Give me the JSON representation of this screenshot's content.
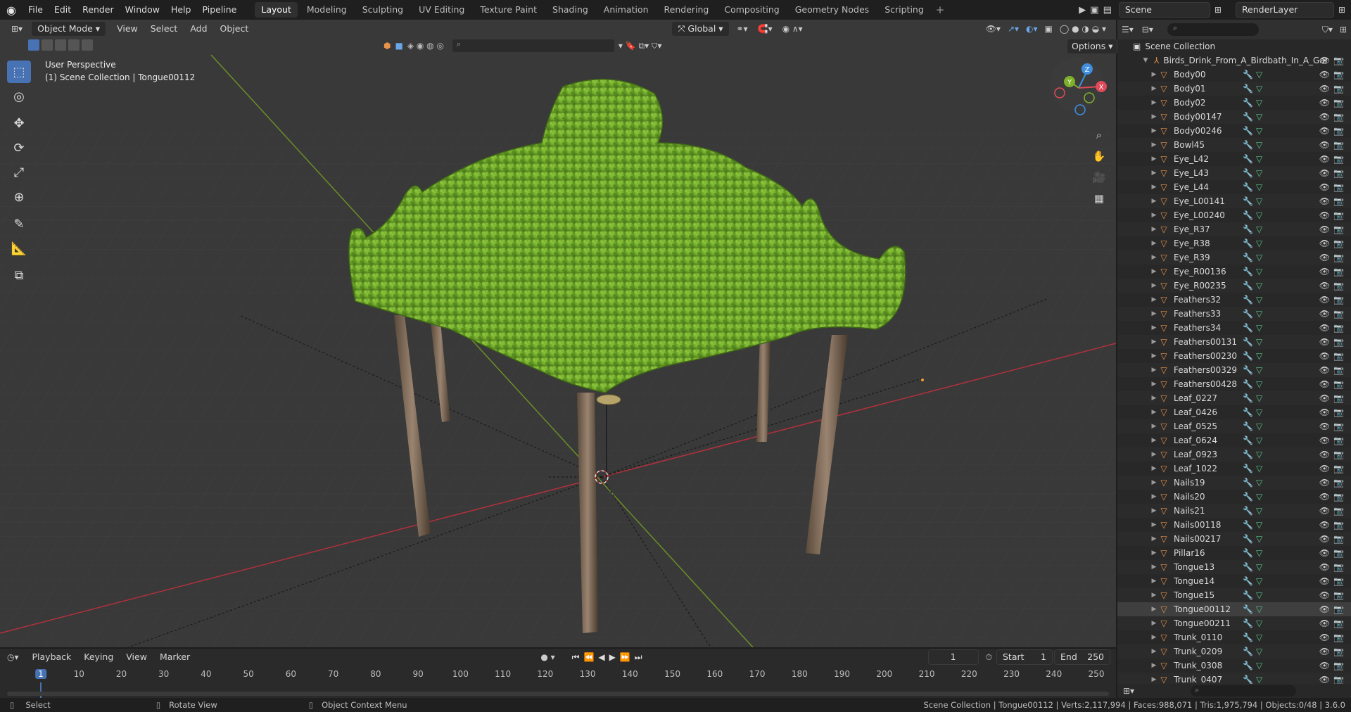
{
  "topbar": {
    "menus": [
      "File",
      "Edit",
      "Render",
      "Window",
      "Help",
      "Pipeline"
    ],
    "workspaces": [
      "Layout",
      "Modeling",
      "Sculpting",
      "UV Editing",
      "Texture Paint",
      "Shading",
      "Animation",
      "Rendering",
      "Compositing",
      "Geometry Nodes",
      "Scripting"
    ],
    "active_workspace": "Layout",
    "scene_name": "Scene",
    "render_layer": "RenderLayer"
  },
  "viewport": {
    "mode": "Object Mode",
    "menus": [
      "View",
      "Select",
      "Add",
      "Object"
    ],
    "transform_orientation": "Global",
    "options_label": "Options",
    "perspective_label": "User Perspective",
    "collection_label": "(1) Scene Collection | Tongue00112"
  },
  "outliner": {
    "root": "Scene Collection",
    "collection": "Birds_Drink_From_A_Birdbath_In_A_Gar",
    "objects": [
      "Body00",
      "Body01",
      "Body02",
      "Body00147",
      "Body00246",
      "Bowl45",
      "Eye_L42",
      "Eye_L43",
      "Eye_L44",
      "Eye_L00141",
      "Eye_L00240",
      "Eye_R37",
      "Eye_R38",
      "Eye_R39",
      "Eye_R00136",
      "Eye_R00235",
      "Feathers32",
      "Feathers33",
      "Feathers34",
      "Feathers00131",
      "Feathers00230",
      "Feathers00329",
      "Feathers00428",
      "Leaf_0227",
      "Leaf_0426",
      "Leaf_0525",
      "Leaf_0624",
      "Leaf_0923",
      "Leaf_1022",
      "Nails19",
      "Nails20",
      "Nails21",
      "Nails00118",
      "Nails00217",
      "Pillar16",
      "Tongue13",
      "Tongue14",
      "Tongue15",
      "Tongue00112",
      "Tongue00211",
      "Trunk_0110",
      "Trunk_0209",
      "Trunk_0308",
      "Trunk_0407"
    ],
    "selected": "Tongue00112"
  },
  "timeline": {
    "menus": [
      "Playback",
      "Keying",
      "View",
      "Marker"
    ],
    "current_frame": "1",
    "start_label": "Start",
    "start": "1",
    "end_label": "End",
    "end": "250",
    "ticks": [
      "1",
      "10",
      "20",
      "30",
      "40",
      "50",
      "60",
      "70",
      "80",
      "90",
      "100",
      "110",
      "120",
      "130",
      "140",
      "150",
      "160",
      "170",
      "180",
      "190",
      "200",
      "210",
      "220",
      "230",
      "240",
      "250"
    ]
  },
  "status": {
    "select": "Select",
    "rotate": "Rotate View",
    "context": "Object Context Menu",
    "stats": "Scene Collection | Tongue00112 | Verts:2,117,994 | Faces:988,071 | Tris:1,975,794 | Objects:0/48 | 3.6.0"
  },
  "colors": {
    "accent": "#4772b3",
    "object_icon": "#e8934a",
    "x_axis": "#e04a5a",
    "y_axis": "#7fb02a",
    "z_axis": "#3f8ee0"
  }
}
